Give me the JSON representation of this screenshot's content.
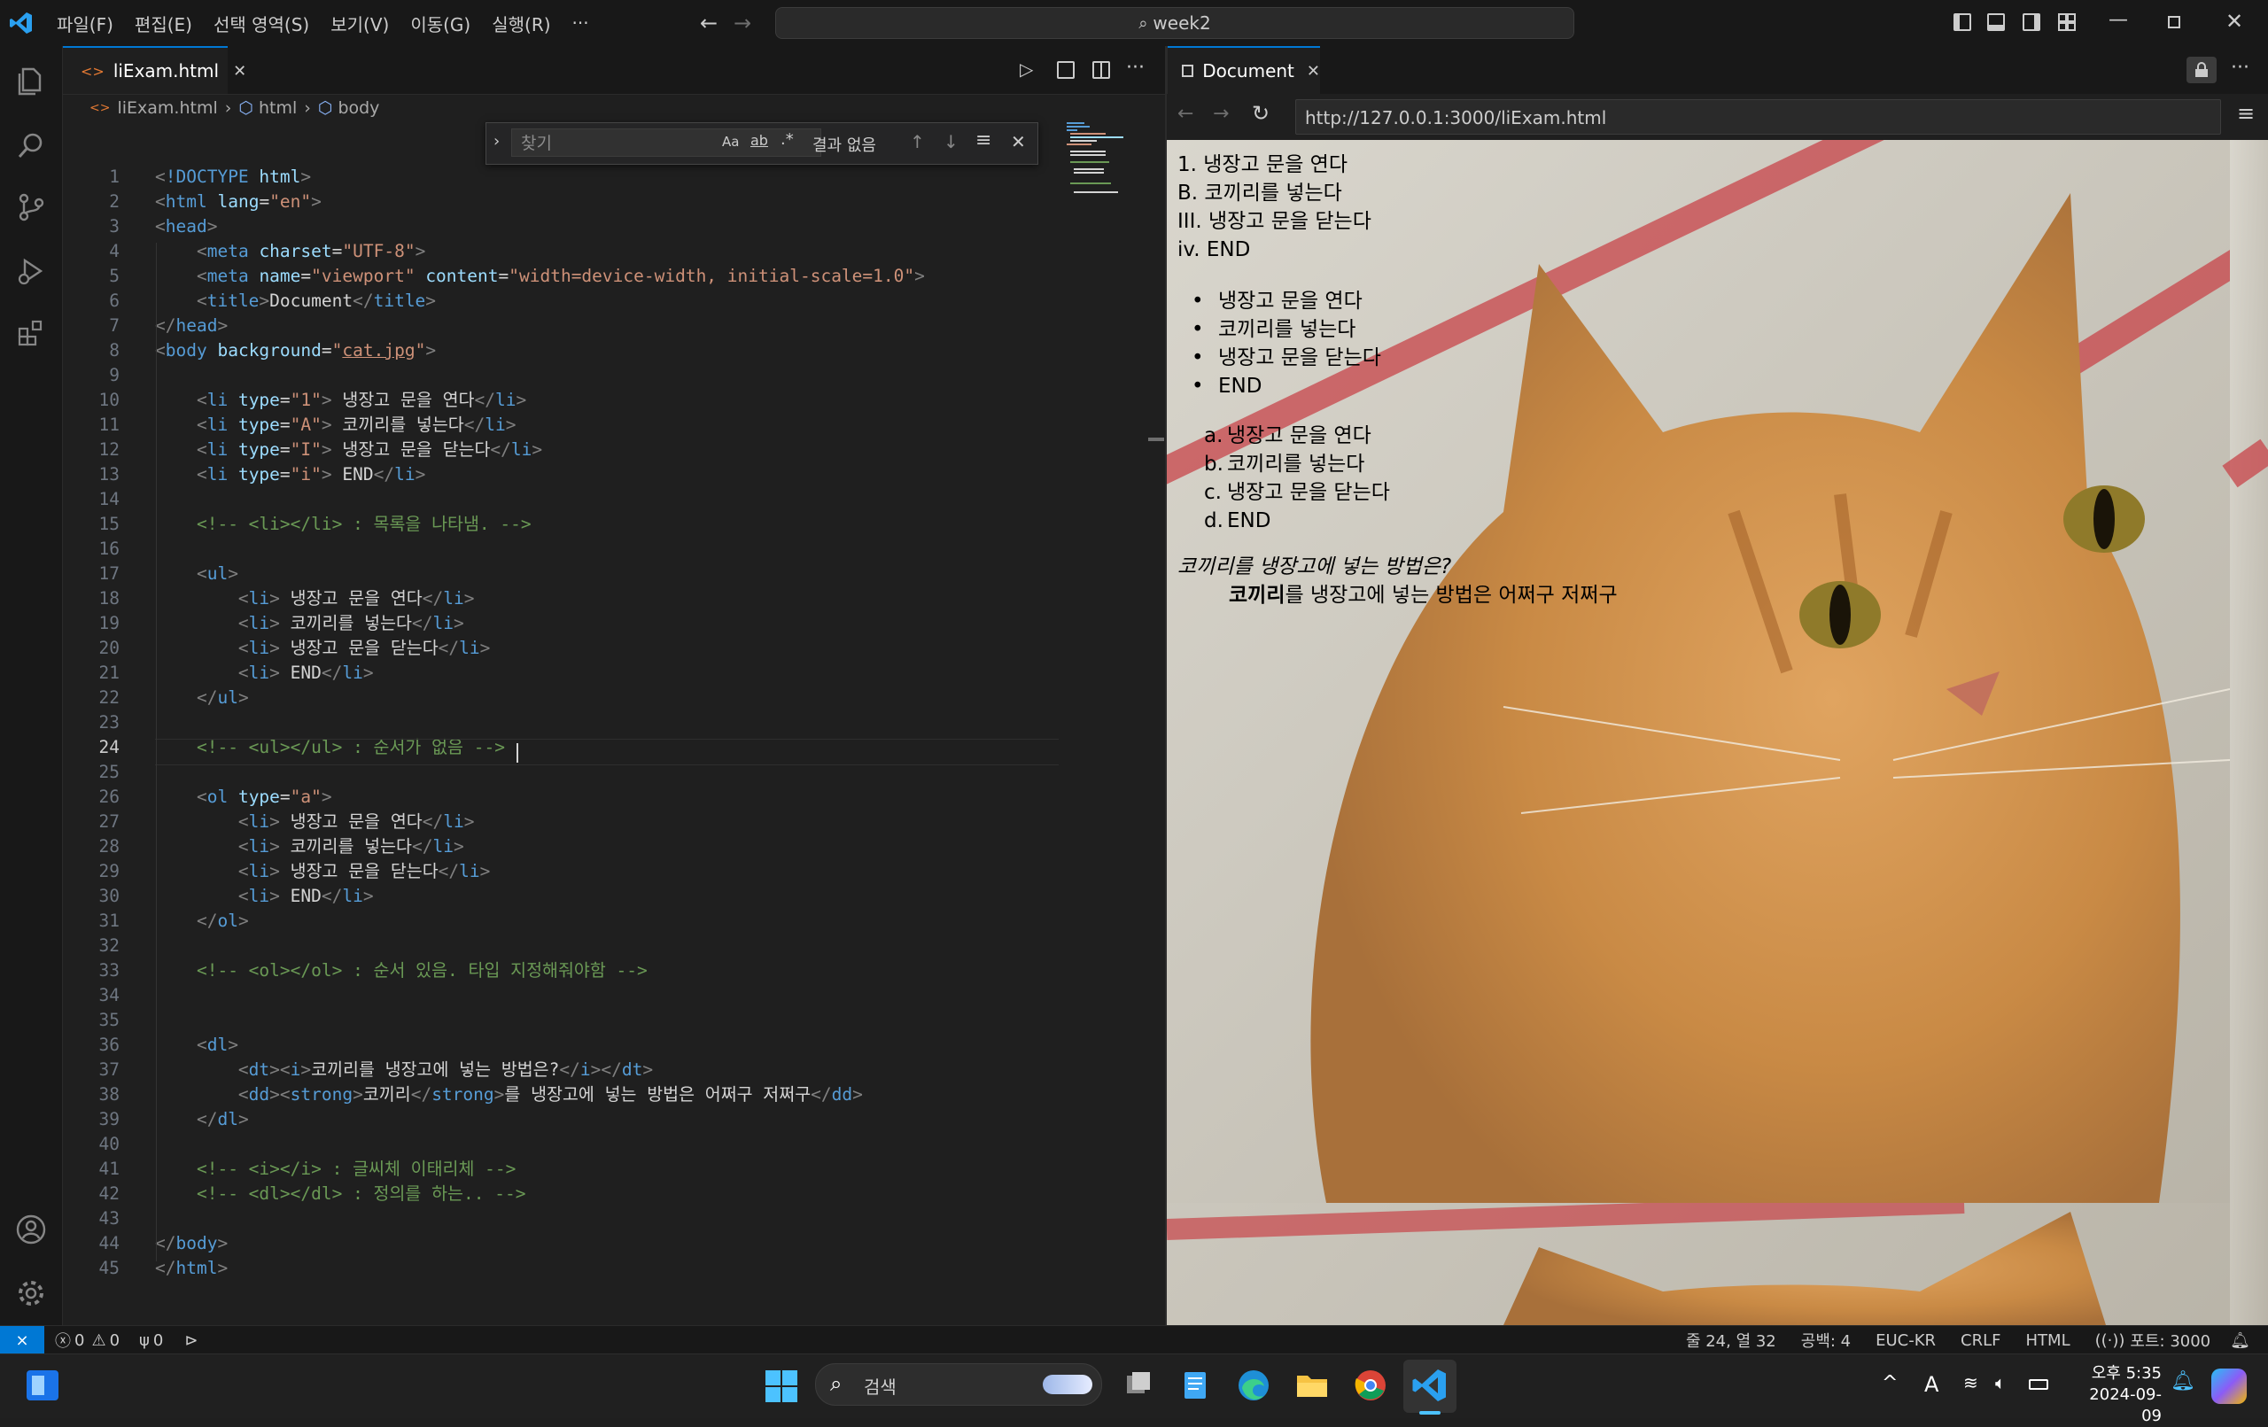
{
  "titlebar": {
    "menus": [
      "파일(F)",
      "편집(E)",
      "선택 영역(S)",
      "보기(V)",
      "이동(G)",
      "실행(R)",
      "···"
    ],
    "search_text": "week2"
  },
  "editor": {
    "tab_label": "liExam.html",
    "breadcrumbs": [
      "liExam.html",
      "html",
      "body"
    ],
    "find": {
      "placeholder": "찾기",
      "case_label": "Aa",
      "word_label": "ab",
      "regex_label": ".*",
      "result": "결과 없음"
    },
    "current_line": 24,
    "lines": [
      "<!DOCTYPE html>",
      "<html lang=\"en\">",
      "<head>",
      "    <meta charset=\"UTF-8\">",
      "    <meta name=\"viewport\" content=\"width=device-width, initial-scale=1.0\">",
      "    <title>Document</title>",
      "</head>",
      "<body background=\"cat.jpg\">",
      "",
      "    <li type=\"1\"> 냉장고 문을 연다</li>",
      "    <li type=\"A\"> 코끼리를 넣는다</li>",
      "    <li type=\"I\"> 냉장고 문을 닫는다</li>",
      "    <li type=\"i\"> END</li>",
      "",
      "    <!-- <li></li> : 목록을 나타냄. -->",
      "",
      "    <ul>",
      "        <li> 냉장고 문을 연다</li>",
      "        <li> 코끼리를 넣는다</li>",
      "        <li> 냉장고 문을 닫는다</li>",
      "        <li> END</li>",
      "    </ul>",
      "",
      "    <!-- <ul></ul> : 순서가 없음 -->",
      "",
      "    <ol type=\"a\">",
      "        <li> 냉장고 문을 연다</li>",
      "        <li> 코끼리를 넣는다</li>",
      "        <li> 냉장고 문을 닫는다</li>",
      "        <li> END</li>",
      "    </ol>",
      "",
      "    <!-- <ol></ol> : 순서 있음. 타입 지정해줘야함 -->",
      "",
      "",
      "    <dl>",
      "        <dt><i>코끼리를 냉장고에 넣는 방법은?</i></dt>",
      "        <dd><strong>코끼리</strong>를 냉장고에 넣는 방법은 어쩌구 저쩌구</dd>",
      "    </dl>",
      "",
      "    <!-- <i></i> : 글씨체 이태리체 -->",
      "    <!-- <dl></dl> : 정의를 하는.. -->",
      "",
      "</body>",
      "</html>"
    ]
  },
  "preview": {
    "tab_label": "Document",
    "url": "http://127.0.0.1:3000/liExam.html",
    "li_list": [
      "1. 냉장고 문을 연다",
      "B. 코끼리를 넣는다",
      "III. 냉장고 문을 닫는다",
      "iv. END"
    ],
    "ul_list": [
      "냉장고 문을 연다",
      "코끼리를 넣는다",
      "냉장고 문을 닫는다",
      "END"
    ],
    "ol_markers": [
      "a.",
      "b.",
      "c.",
      "d."
    ],
    "ol_list": [
      "냉장고 문을 연다",
      "코끼리를 넣는다",
      "냉장고 문을 닫는다",
      "END"
    ],
    "dt": "코끼리를 냉장고에 넣는 방법은?",
    "dd_strong": "코끼리",
    "dd_rest": "를 냉장고에 넣는 방법은 어쩌구 저쩌구"
  },
  "statusbar": {
    "errors": "0",
    "warnings": "0",
    "ports_count": "0",
    "position": "줄 24, 열 32",
    "spaces": "공백: 4",
    "encoding": "EUC-KR",
    "eol": "CRLF",
    "language": "HTML",
    "port": "포트: 3000"
  },
  "taskbar": {
    "search_placeholder": "검색",
    "time": "오후 5:35",
    "date": "2024-09-09",
    "ime": "A"
  },
  "colors": {
    "accent": "#0078d4",
    "editor_bg": "#1f1f1f",
    "chrome_bg": "#181818"
  }
}
